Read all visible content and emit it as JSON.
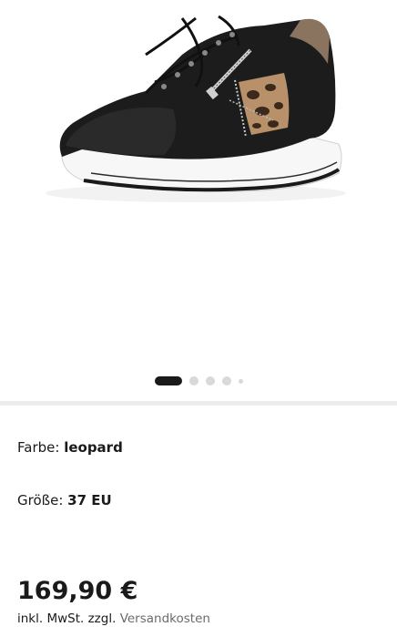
{
  "gallery": {
    "image_alt": "sneaker-black-leopard",
    "pager": {
      "count": 5,
      "active_index": 0
    }
  },
  "attributes": {
    "color": {
      "label": "Farbe:",
      "value": "leopard"
    },
    "size": {
      "label": "Größe:",
      "value": "37 EU"
    }
  },
  "price": {
    "amount": "169,90 €",
    "tax_note": "inkl. MwSt. zzgl.",
    "shipping_link": "Versandkosten"
  },
  "colors": {
    "text": "#1a1a1a",
    "pager_active": "#1a1a1a",
    "pager_inactive": "#d9d9d9",
    "divider": "#ececec",
    "link_gray": "#6b6b6b"
  }
}
